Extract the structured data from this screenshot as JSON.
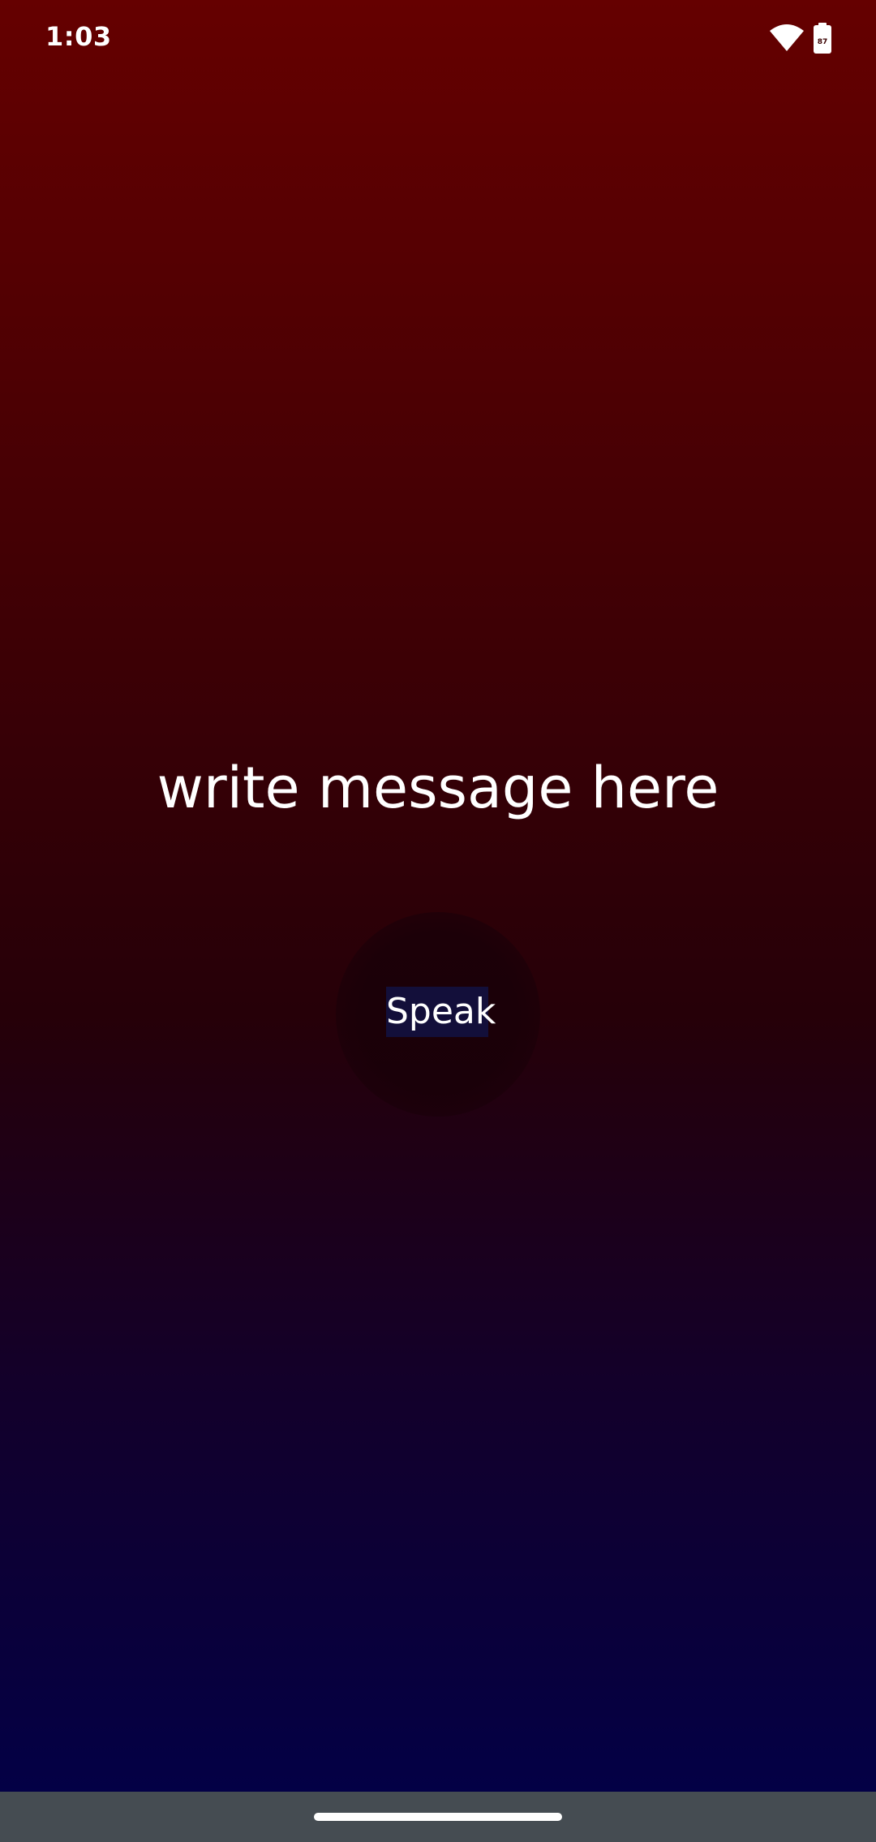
{
  "status_bar": {
    "time": "1:03",
    "battery_level": "87",
    "icons": [
      "wifi-icon",
      "battery-icon"
    ]
  },
  "main": {
    "message": "write message here",
    "speak_label": "Speak"
  },
  "colors": {
    "gradient_top": "#650000",
    "gradient_bottom": "#010049",
    "speak_label_bg": "#130f3a",
    "nav_bar": "#454c52"
  }
}
